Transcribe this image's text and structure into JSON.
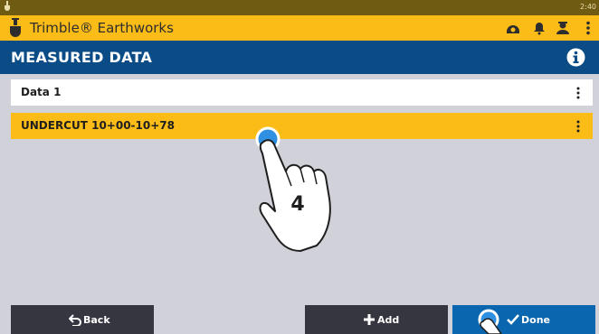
{
  "status_bar": {
    "time": "2:40"
  },
  "app_bar": {
    "title": "Trimble® Earthworks",
    "icons": [
      "trimble-logo-icon",
      "dashboard-icon",
      "bell-icon",
      "user-icon",
      "more-vertical-icon"
    ]
  },
  "page": {
    "title": "MEASURED DATA"
  },
  "list": {
    "items": [
      {
        "label": "Data 1",
        "selected": false
      },
      {
        "label": "UNDERCUT 10+00-10+78",
        "selected": true
      }
    ]
  },
  "overlay": {
    "step_number": "4"
  },
  "footer": {
    "back_label": "Back",
    "add_label": "Add",
    "done_label": "Done"
  },
  "colors": {
    "accent_yellow": "#fcbc17",
    "header_blue": "#0b4c86",
    "done_blue": "#0a66ae",
    "button_dark": "#363640",
    "background": "#d1d1d9"
  }
}
